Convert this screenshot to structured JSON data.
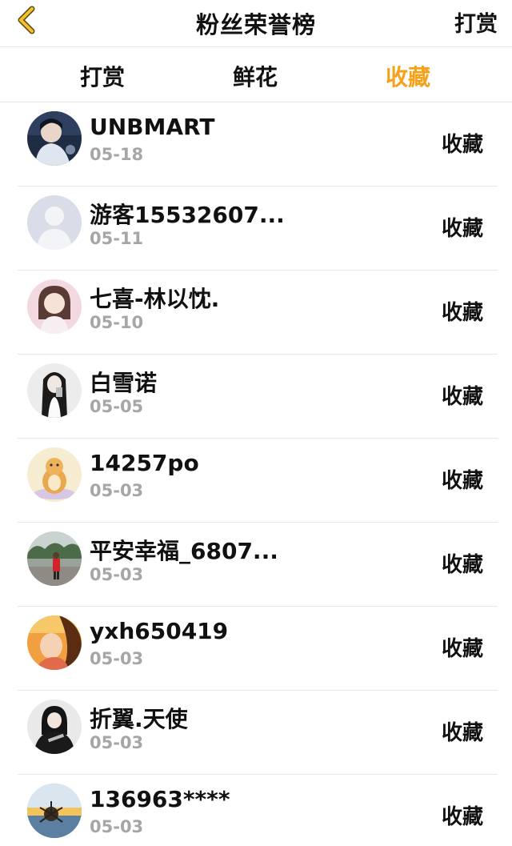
{
  "header": {
    "title": "粉丝荣誉榜",
    "right_action": "打赏"
  },
  "tabs": [
    {
      "label": "打赏",
      "active": false
    },
    {
      "label": "鲜花",
      "active": false
    },
    {
      "label": "收藏",
      "active": true
    }
  ],
  "colors": {
    "accent": "#f5a21b",
    "date_gray": "#a6a6a6",
    "divider": "#e8e8e8"
  },
  "fans": [
    {
      "name": "UNBMART",
      "date": "05-18",
      "action": "收藏"
    },
    {
      "name": "游客15532607...",
      "date": "05-11",
      "action": "收藏"
    },
    {
      "name": "七喜-林以忱.",
      "date": "05-10",
      "action": "收藏"
    },
    {
      "name": "白雪诺",
      "date": "05-05",
      "action": "收藏"
    },
    {
      "name": "14257po",
      "date": "05-03",
      "action": "收藏"
    },
    {
      "name": "平安幸福_6807...",
      "date": "05-03",
      "action": "收藏"
    },
    {
      "name": "yxh650419",
      "date": "05-03",
      "action": "收藏"
    },
    {
      "name": "折翼.天使",
      "date": "05-03",
      "action": "收藏"
    },
    {
      "name": "136963****",
      "date": "05-03",
      "action": "收藏"
    }
  ]
}
